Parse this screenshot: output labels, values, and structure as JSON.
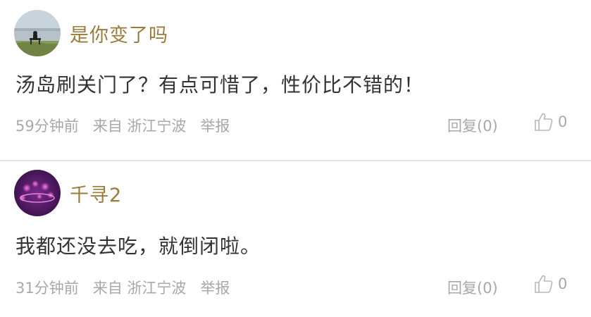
{
  "comments": [
    {
      "username": "是你变了吗",
      "content": "汤岛刷关门了？有点可惜了，性价比不错的！",
      "time": "59分钟前",
      "from_label": "来自 浙江宁波",
      "report_label": "举报",
      "reply_label": "回复(0)",
      "like_count": "0",
      "avatar_icon": "avatar-lakeside-bench-icon"
    },
    {
      "username": "千寻2",
      "content": "我都还没去吃，就倒闭啦。",
      "time": "31分钟前",
      "from_label": "来自 浙江宁波",
      "report_label": "举报",
      "reply_label": "回复(0)",
      "like_count": "0",
      "avatar_icon": "avatar-purple-bokeh-icon"
    }
  ],
  "colors": {
    "username": "#9a7b3c",
    "content": "#333333",
    "meta": "#a8a8a8",
    "divider": "#e2e2e2"
  },
  "icons": {
    "like": "thumbs-up-icon"
  }
}
